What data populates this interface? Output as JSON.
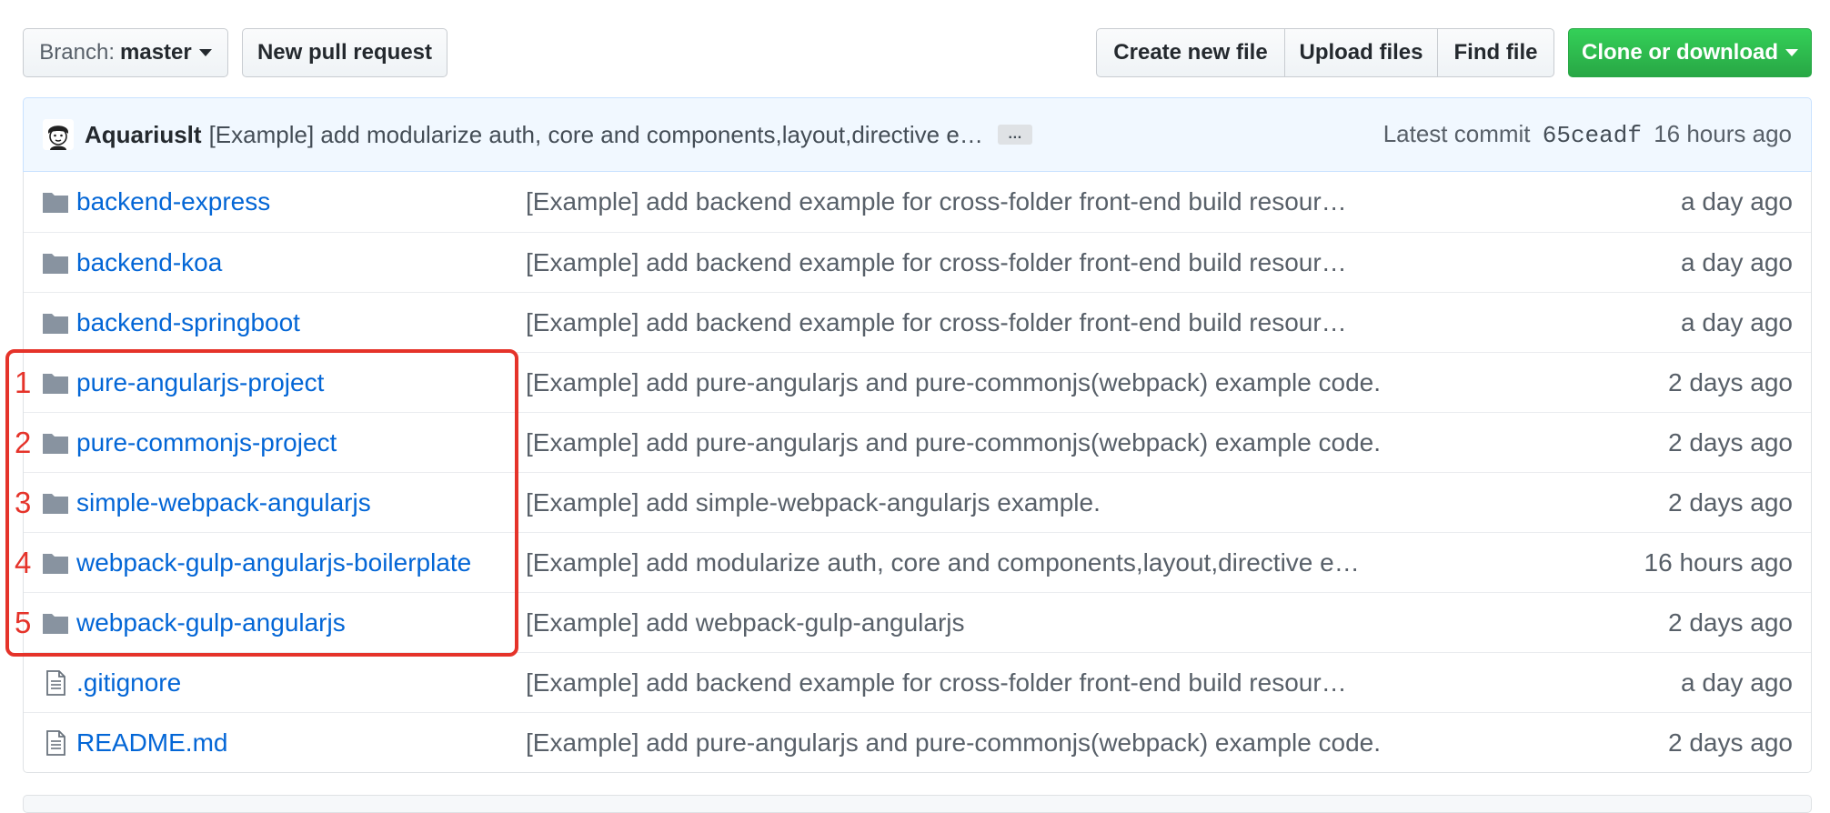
{
  "toolbar": {
    "branch_label": "Branch:",
    "branch_value": "master",
    "new_pull_request": "New pull request",
    "create_new_file": "Create new file",
    "upload_files": "Upload files",
    "find_file": "Find file",
    "clone_or_download": "Clone or download"
  },
  "commit": {
    "author": "Aquariuslt",
    "message": "[Example] add modularize auth, core and components,layout,directive e…",
    "ellipsis": "…",
    "latest_label": "Latest commit",
    "sha": "65ceadf",
    "age": "16 hours ago"
  },
  "files": [
    {
      "type": "folder",
      "name": "backend-express",
      "message": "[Example] add backend example for cross-folder front-end build resour…",
      "age": "a day ago"
    },
    {
      "type": "folder",
      "name": "backend-koa",
      "message": "[Example] add backend example for cross-folder front-end build resour…",
      "age": "a day ago"
    },
    {
      "type": "folder",
      "name": "backend-springboot",
      "message": "[Example] add backend example for cross-folder front-end build resour…",
      "age": "a day ago"
    },
    {
      "type": "folder",
      "name": "pure-angularjs-project",
      "message": "[Example] add pure-angularjs and pure-commonjs(webpack) example code.",
      "age": "2 days ago"
    },
    {
      "type": "folder",
      "name": "pure-commonjs-project",
      "message": "[Example] add pure-angularjs and pure-commonjs(webpack) example code.",
      "age": "2 days ago"
    },
    {
      "type": "folder",
      "name": "simple-webpack-angularjs",
      "message": "[Example] add simple-webpack-angularjs example.",
      "age": "2 days ago"
    },
    {
      "type": "folder",
      "name": "webpack-gulp-angularjs-boilerplate",
      "message": "[Example] add modularize auth, core and components,layout,directive e…",
      "age": "16 hours ago"
    },
    {
      "type": "folder",
      "name": "webpack-gulp-angularjs",
      "message": "[Example] add webpack-gulp-angularjs",
      "age": "2 days ago"
    },
    {
      "type": "file",
      "name": ".gitignore",
      "message": "[Example] add backend example for cross-folder front-end build resour…",
      "age": "a day ago"
    },
    {
      "type": "file",
      "name": "README.md",
      "message": "[Example] add pure-angularjs and pure-commonjs(webpack) example code.",
      "age": "2 days ago"
    }
  ],
  "annotation": {
    "color": "#e5332a",
    "numbers": [
      "1",
      "2",
      "3",
      "4",
      "5"
    ]
  },
  "colors": {
    "link": "#0366d6",
    "clone_button": "#28a745",
    "commit_bar_bg": "#f1f8ff",
    "folder_icon": "#79b8ff"
  },
  "icons": {
    "folder": "folder-icon",
    "file": "file-text-icon",
    "avatar": "avatar"
  }
}
